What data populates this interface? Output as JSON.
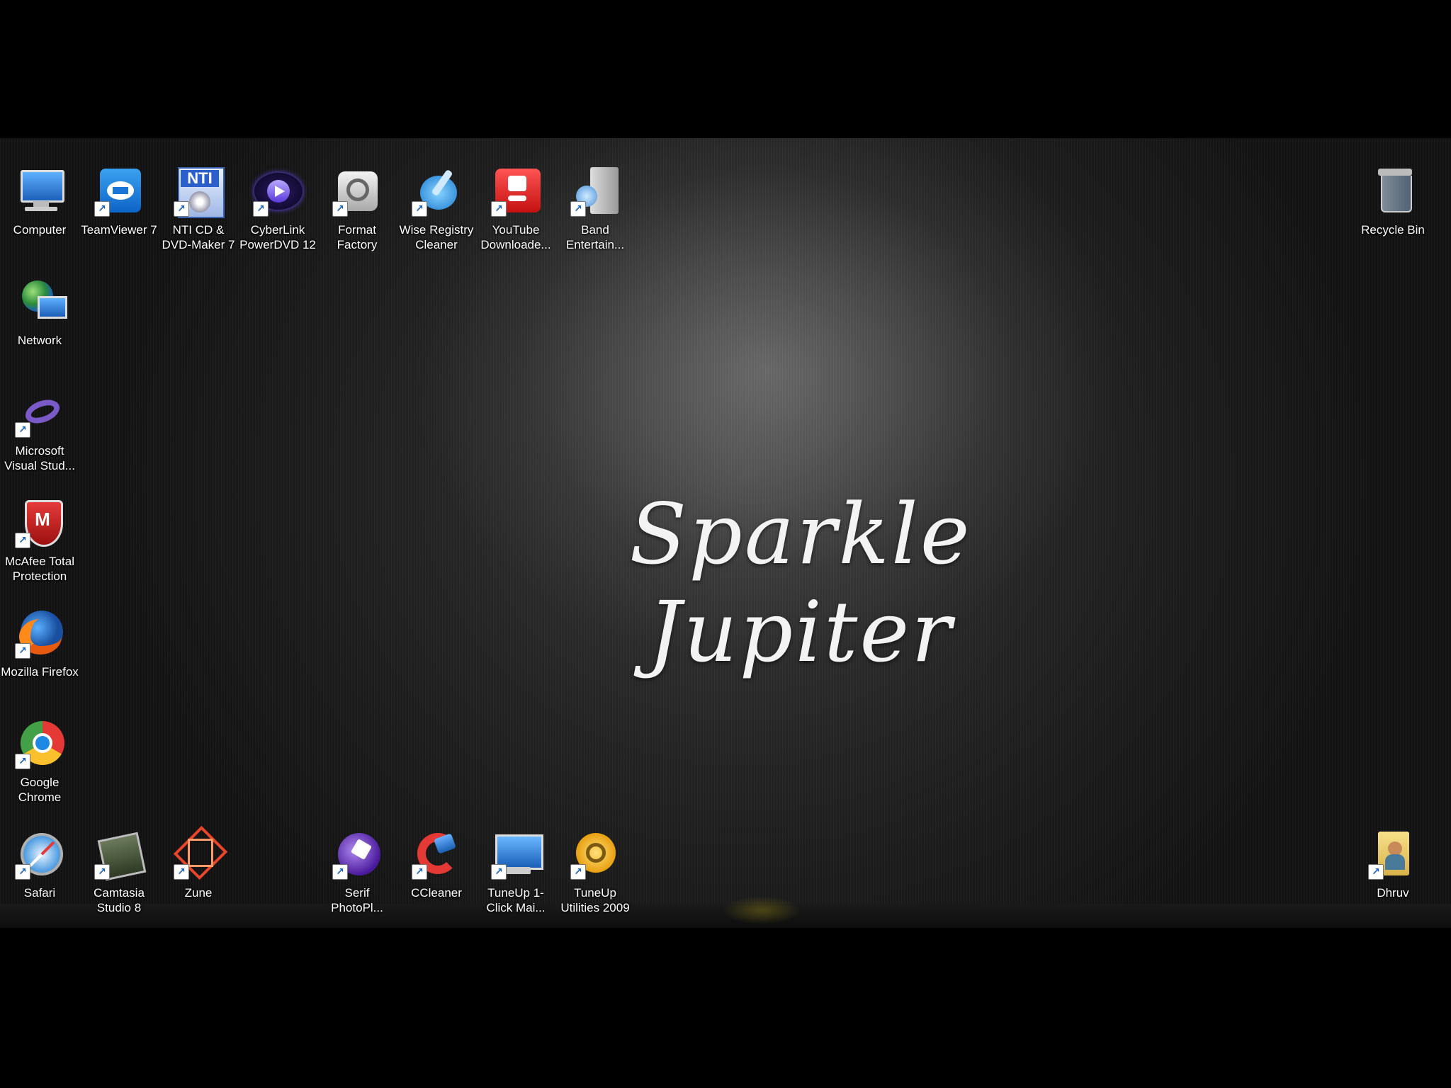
{
  "wallpaper": {
    "title": "Sparkle Jupiter"
  },
  "icons": {
    "computer": "Computer",
    "teamviewer": "TeamViewer 7",
    "nti": "NTI CD & DVD-Maker 7",
    "cyberlink": "CyberLink PowerDVD 12",
    "format_factory": "Format Factory",
    "wise_registry": "Wise Registry Cleaner",
    "youtube_downloader": "YouTube Downloade...",
    "band": "Band Entertain...",
    "recycle_bin": "Recycle Bin",
    "network": "Network",
    "visual_studio": "Microsoft Visual Stud...",
    "mcafee": "McAfee Total Protection",
    "firefox": "Mozilla Firefox",
    "chrome": "Google Chrome",
    "safari": "Safari",
    "camtasia": "Camtasia Studio 8",
    "zune": "Zune",
    "serif": "Serif PhotoPl...",
    "ccleaner": "CCleaner",
    "tuneup1": "TuneUp 1-Click Mai...",
    "tuneup2": "TuneUp Utilities 2009",
    "dhruv": "Dhruv"
  },
  "colors": {
    "accent": "#f3f3f3",
    "background": "#000000"
  }
}
